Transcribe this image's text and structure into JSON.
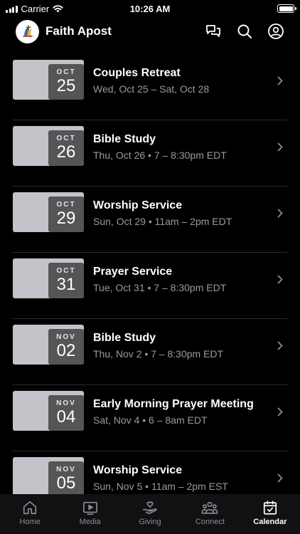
{
  "status_bar": {
    "carrier": "Carrier",
    "time": "10:26 AM"
  },
  "header": {
    "title": "Faith Apost"
  },
  "events": [
    {
      "month": "OCT",
      "day": "25",
      "title": "Couples Retreat",
      "subtitle": "Wed, Oct 25 – Sat, Oct 28"
    },
    {
      "month": "OCT",
      "day": "26",
      "title": "Bible Study",
      "subtitle": "Thu, Oct 26 • 7 – 8:30pm EDT"
    },
    {
      "month": "OCT",
      "day": "29",
      "title": "Worship Service",
      "subtitle": "Sun, Oct 29 • 11am – 2pm EDT"
    },
    {
      "month": "OCT",
      "day": "31",
      "title": "Prayer Service",
      "subtitle": "Tue, Oct 31 • 7 – 8:30pm EDT"
    },
    {
      "month": "NOV",
      "day": "02",
      "title": "Bible Study",
      "subtitle": "Thu, Nov 2 • 7 – 8:30pm EDT"
    },
    {
      "month": "NOV",
      "day": "04",
      "title": "Early Morning Prayer Meeting",
      "subtitle": "Sat, Nov 4 • 6 – 8am EDT"
    },
    {
      "month": "NOV",
      "day": "05",
      "title": "Worship Service",
      "subtitle": "Sun, Nov 5 • 11am – 2pm EST"
    }
  ],
  "tabs": [
    {
      "label": "Home",
      "icon": "home-icon"
    },
    {
      "label": "Media",
      "icon": "play-icon"
    },
    {
      "label": "Giving",
      "icon": "giving-hand-icon"
    },
    {
      "label": "Connect",
      "icon": "people-icon"
    },
    {
      "label": "Calendar",
      "icon": "calendar-icon",
      "active": true
    }
  ],
  "colors": {
    "background": "#000000",
    "thumbnail": "#c3c4ca",
    "date_badge": "#555558",
    "subtitle": "#9a9aa0",
    "tab_inactive": "#8e8e93"
  }
}
